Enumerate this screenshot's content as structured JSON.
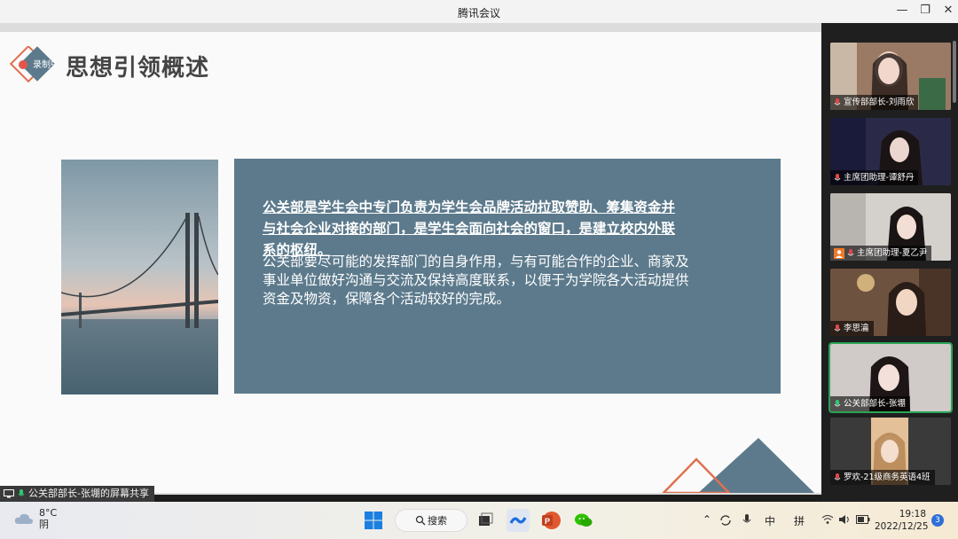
{
  "window": {
    "title": "腾讯会议",
    "min_glyph": "—",
    "max_glyph": "❐",
    "close_glyph": "✕"
  },
  "slide": {
    "record_tag": "录制中",
    "title": "思想引领概述",
    "lead_text": "公关部是学生会中专门负责为学生会品牌活动拉取赞助、筹集资金并与社会企业对接的部门，是学生会面向社会的窗口，是建立校内外联系的枢纽。",
    "body_text": "公关部要尽可能的发挥部门的自身作用，与有可能合作的企业、商家及事业单位做好沟通与交流及保持高度联系，以便于为学院各大活动提供资金及物资，保障各个活动较好的完成。",
    "accent_colors": {
      "box": "#5c7a8c",
      "triangle_outline": "#e0704f",
      "triangle_fill": "#5c7a8c"
    }
  },
  "share_banner": "公关部部长-张堋的屏幕共享",
  "participants": [
    {
      "name": "宣传部部长-刘雨欣",
      "bg": "#8a6a58"
    },
    {
      "name": "主席团助理-谭舒丹",
      "bg": "#3a3550"
    },
    {
      "name": "主席团助理-夏乙尹",
      "bg": "#d8d4d0"
    },
    {
      "name": "李思瀹",
      "bg": "#7a5a44"
    },
    {
      "name": "公关部部长-张堋",
      "bg": "#cfc7c4",
      "active": true
    },
    {
      "name": "罗欢-21级商务英语4班",
      "bg": "#3a3a3a"
    }
  ],
  "taskbar": {
    "temperature": "8°C",
    "condition": "阴",
    "search_label": "搜索",
    "ime1": "中",
    "ime2": "拼",
    "time": "19:18",
    "date": "2022/12/25",
    "notifications": "3"
  }
}
